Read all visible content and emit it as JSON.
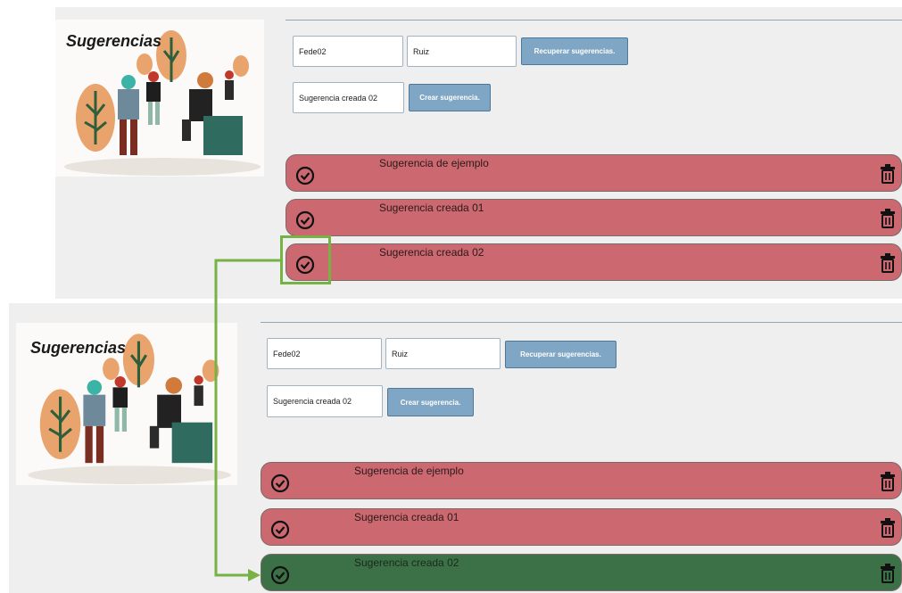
{
  "logo": {
    "title": "Sugerencias"
  },
  "form": {
    "user_value": "Fede02",
    "surname_value": "Ruiz",
    "recover_label": "Recuperar sugerencias.",
    "suggestion_value": "Sugerencia creada 02",
    "create_label": "Crear sugerencia."
  },
  "before": {
    "cards": [
      {
        "text": "Sugerencia de ejemplo",
        "state": "pending"
      },
      {
        "text": "Sugerencia creada 01",
        "state": "pending"
      },
      {
        "text": "Sugerencia creada 02",
        "state": "pending"
      }
    ]
  },
  "after": {
    "cards": [
      {
        "text": "Sugerencia de ejemplo",
        "state": "pending"
      },
      {
        "text": "Sugerencia creada 01",
        "state": "pending"
      },
      {
        "text": "Sugerencia creada 02",
        "state": "accepted"
      }
    ]
  },
  "colors": {
    "pending": "#cc6870",
    "accepted": "#3c7047",
    "highlight": "#77b244",
    "button": "#7fa6c4"
  },
  "icons": {
    "accept": "check-circle-icon",
    "delete": "trash-icon"
  }
}
